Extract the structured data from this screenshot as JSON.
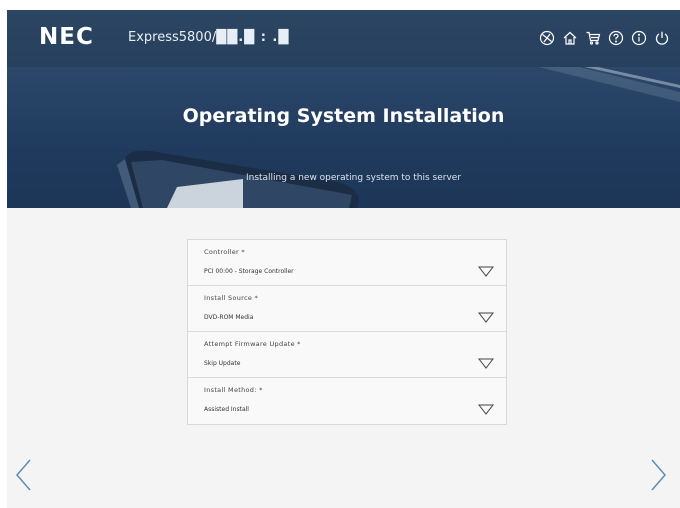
{
  "header": {
    "brand": "NEC",
    "product_prefix": "Express5800/",
    "product_model": "██.█ : .█",
    "icons": [
      "globe-icon",
      "home-icon",
      "cart-icon",
      "help-icon",
      "info-icon",
      "power-icon"
    ]
  },
  "hero": {
    "title": "Operating System Installation",
    "subtitle": "Installing a new operating system to this server"
  },
  "form": {
    "fields": [
      {
        "label": "Controller *",
        "value": "PCI 00:00 - Storage Controller"
      },
      {
        "label": "Install Source *",
        "value": "DVD-ROM Media"
      },
      {
        "label": "Attempt Firmware Update *",
        "value": "Skip Update"
      },
      {
        "label": "Install Method: *",
        "value": "Assisted Install"
      }
    ]
  },
  "colors": {
    "header_bg": "#2b4563",
    "hero_bg": "#1f3a5c",
    "page_bg": "#f4f4f4",
    "arrow": "#5b8db8"
  }
}
